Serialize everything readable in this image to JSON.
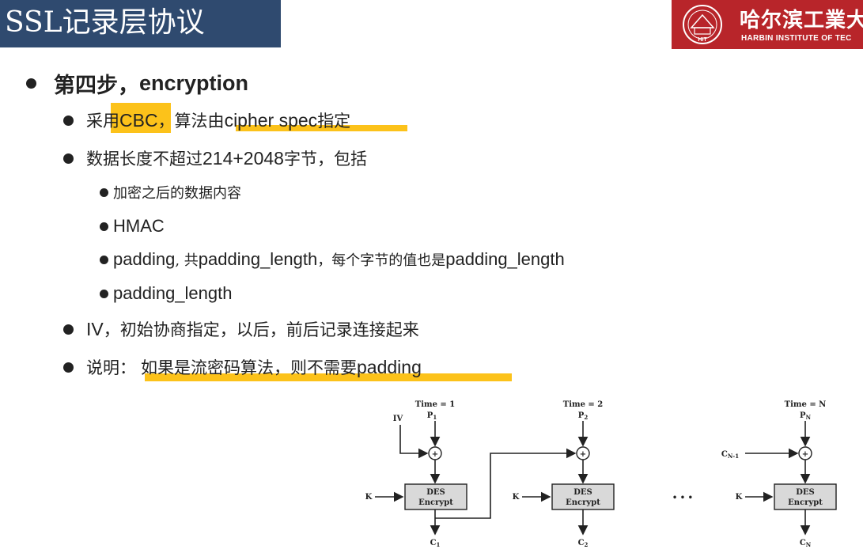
{
  "title": "SSL记录层协议",
  "logo": {
    "cn": "哈尔滨工業大",
    "en": "HARBIN INSTITUTE OF TEC",
    "emblem_text": "HIT"
  },
  "bullets": {
    "step": {
      "cn": "第四步，",
      "en": "encryption"
    },
    "cbc": {
      "a": "采用",
      "b": "CBC",
      "c": "，算法由",
      "d": "cipher spec",
      "e": "指定"
    },
    "len": {
      "a": "数据长度不超过",
      "b": "214+2048",
      "c": "字节，包括"
    },
    "sub1": "加密之后的数据内容",
    "sub2": "HMAC",
    "sub3": {
      "a": "padding",
      "b": ", 共",
      "c": "padding_length",
      "d": "，每个字节的值也是",
      "e": "padding_length"
    },
    "sub4": "padding_length",
    "iv": {
      "a": "IV",
      "b": "，初始协商指定，以后，前后记录连接起来"
    },
    "note": {
      "a": "说明：",
      "b": "如果是流密码算法，则不需要",
      "c": "padding"
    }
  },
  "diagram": {
    "stages": [
      {
        "time": "Time = 1",
        "p": "P",
        "p_sub": "1",
        "c": "C",
        "c_sub": "1",
        "chain": "IV"
      },
      {
        "time": "Time = 2",
        "p": "P",
        "p_sub": "2",
        "c": "C",
        "c_sub": "2",
        "chain": ""
      },
      {
        "time": "Time = N",
        "p": "P",
        "p_sub": "N",
        "c": "C",
        "c_sub": "N",
        "chain": "C",
        "chain_sub": "N-1"
      }
    ],
    "key": "K",
    "box_line1": "DES",
    "box_line2": "Encrypt",
    "ellipsis": "•  •  •",
    "xor": "+"
  },
  "colors": {
    "title_bg": "#2f4a6f",
    "logo_bg": "#b8252a",
    "highlight": "#fcc21a"
  }
}
